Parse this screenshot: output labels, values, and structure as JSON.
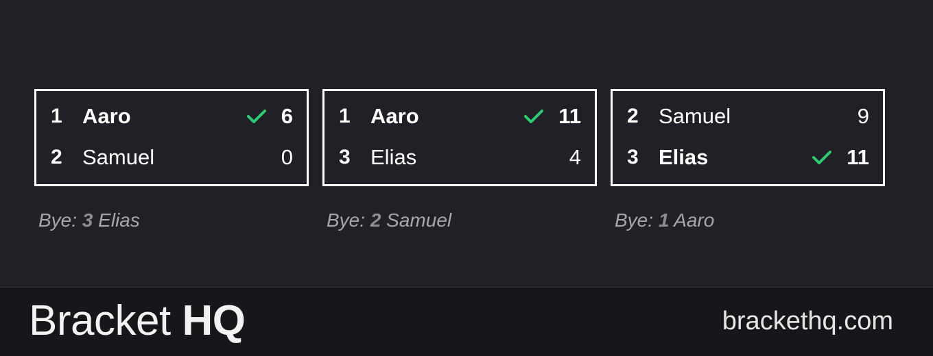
{
  "colors": {
    "background": "#202126",
    "footer_background": "#16171b",
    "winner_check": "#2ecc71",
    "text": "#ffffff",
    "bye_text": "#a6a7ab"
  },
  "matches": [
    {
      "players": [
        {
          "seed": "1",
          "name": "Aaro",
          "score": "6",
          "winner": true
        },
        {
          "seed": "2",
          "name": "Samuel",
          "score": "0",
          "winner": false
        }
      ],
      "bye": {
        "label": "Bye:",
        "seed": "3",
        "name": "Elias"
      }
    },
    {
      "players": [
        {
          "seed": "1",
          "name": "Aaro",
          "score": "11",
          "winner": true
        },
        {
          "seed": "3",
          "name": "Elias",
          "score": "4",
          "winner": false
        }
      ],
      "bye": {
        "label": "Bye:",
        "seed": "2",
        "name": "Samuel"
      }
    },
    {
      "players": [
        {
          "seed": "2",
          "name": "Samuel",
          "score": "9",
          "winner": false
        },
        {
          "seed": "3",
          "name": "Elias",
          "score": "11",
          "winner": true
        }
      ],
      "bye": {
        "label": "Bye:",
        "seed": "1",
        "name": "Aaro"
      }
    }
  ],
  "footer": {
    "brand_prefix": "Bracket",
    "brand_suffix": "HQ",
    "site": "brackethq.com"
  }
}
